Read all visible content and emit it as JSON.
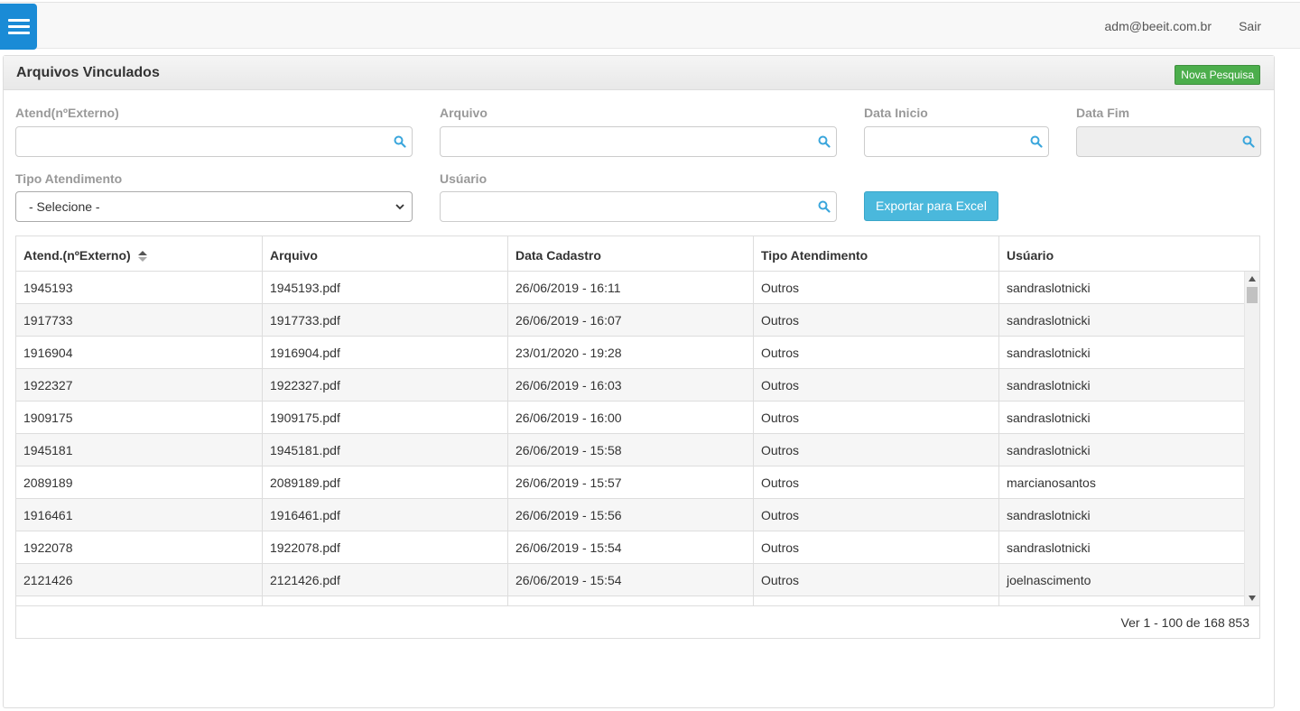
{
  "header": {
    "user_email": "adm@beeit.com.br",
    "logout_label": "Sair"
  },
  "panel": {
    "title": "Arquivos Vinculados",
    "new_search_label": "Nova Pesquisa"
  },
  "filters": {
    "atend_label": "Atend(nºExterno)",
    "arquivo_label": "Arquivo",
    "data_inicio_label": "Data Inicio",
    "data_fim_label": "Data Fim",
    "tipo_label": "Tipo Atendimento",
    "tipo_selected": "- Selecione -",
    "usuario_label": "Usúario",
    "export_label": "Exportar para Excel"
  },
  "table": {
    "columns": [
      "Atend.(nºExterno)",
      "Arquivo",
      "Data Cadastro",
      "Tipo Atendimento",
      "Usúario"
    ],
    "rows": [
      [
        "1945193",
        "1945193.pdf",
        "26/06/2019 - 16:11",
        "Outros",
        "sandraslotnicki"
      ],
      [
        "1917733",
        "1917733.pdf",
        "26/06/2019 - 16:07",
        "Outros",
        "sandraslotnicki"
      ],
      [
        "1916904",
        "1916904.pdf",
        "23/01/2020 - 19:28",
        "Outros",
        "sandraslotnicki"
      ],
      [
        "1922327",
        "1922327.pdf",
        "26/06/2019 - 16:03",
        "Outros",
        "sandraslotnicki"
      ],
      [
        "1909175",
        "1909175.pdf",
        "26/06/2019 - 16:00",
        "Outros",
        "sandraslotnicki"
      ],
      [
        "1945181",
        "1945181.pdf",
        "26/06/2019 - 15:58",
        "Outros",
        "sandraslotnicki"
      ],
      [
        "2089189",
        "2089189.pdf",
        "26/06/2019 - 15:57",
        "Outros",
        "marcianosantos"
      ],
      [
        "1916461",
        "1916461.pdf",
        "26/06/2019 - 15:56",
        "Outros",
        "sandraslotnicki"
      ],
      [
        "1922078",
        "1922078.pdf",
        "26/06/2019 - 15:54",
        "Outros",
        "sandraslotnicki"
      ],
      [
        "2121426",
        "2121426.pdf",
        "26/06/2019 - 15:54",
        "Outros",
        "joelnascimento"
      ],
      [
        "",
        "",
        "",
        "",
        ""
      ]
    ],
    "pager_info": "Ver 1 - 100 de 168 853"
  },
  "colors": {
    "menu": "#1a8bd6",
    "new_search": "#4cae4c",
    "export": "#4ab8dc",
    "search_icon": "#3aa6dc"
  }
}
